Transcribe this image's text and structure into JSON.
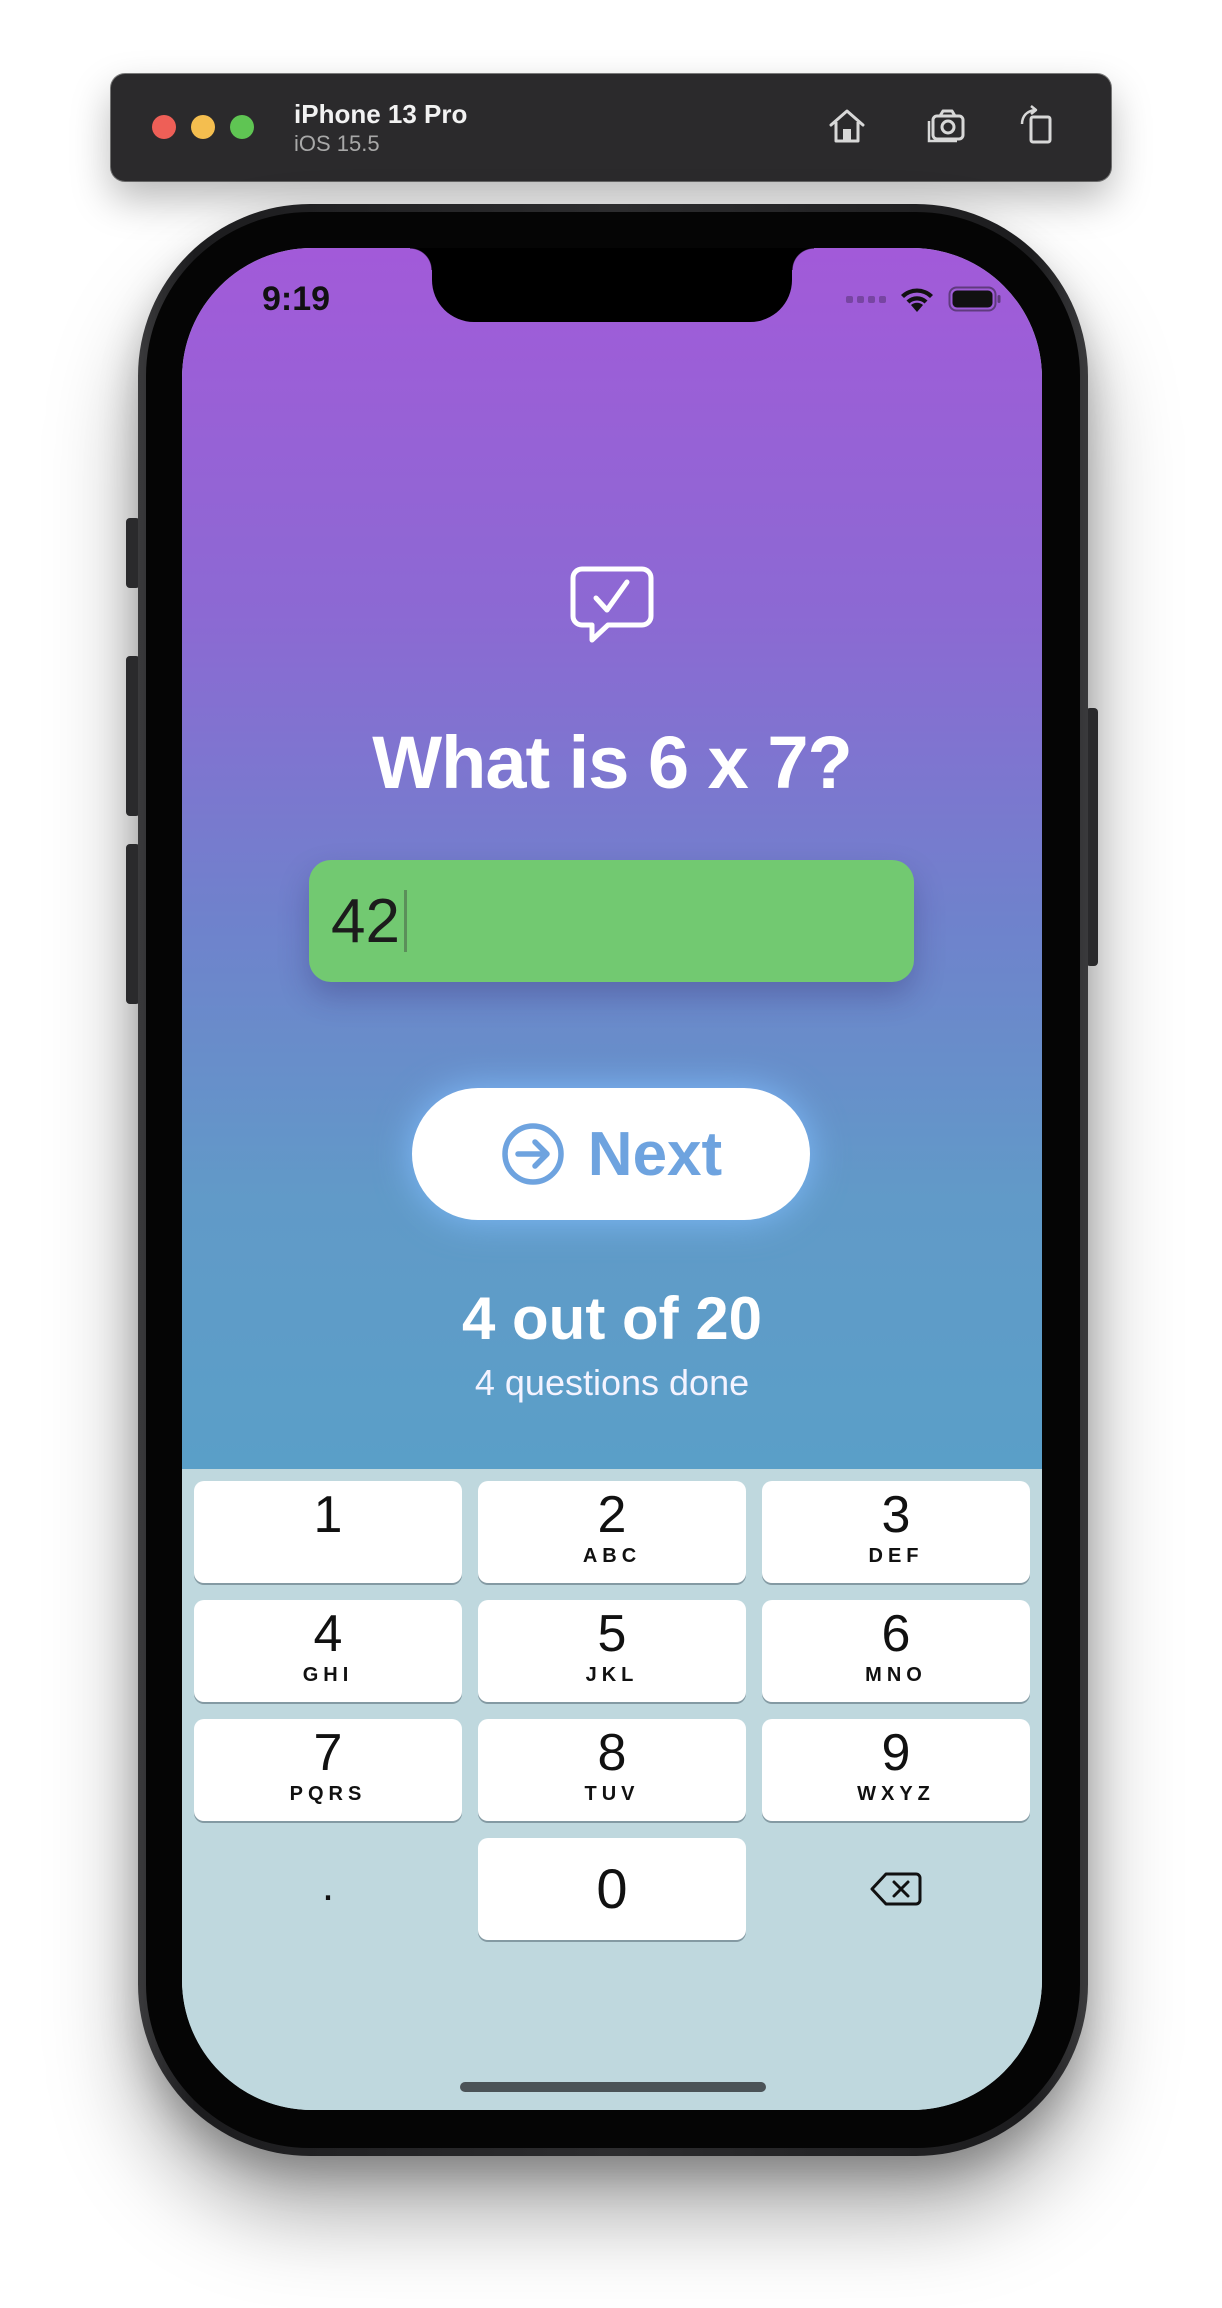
{
  "simulator": {
    "device_name": "iPhone 13 Pro",
    "os_version": "iOS 15.5",
    "buttons": [
      {
        "name": "home-icon"
      },
      {
        "name": "screenshot-icon"
      },
      {
        "name": "rotate-icon"
      }
    ]
  },
  "status_bar": {
    "time": "9:19",
    "icons": [
      "signal-dots-icon",
      "wifi-icon",
      "battery-icon"
    ]
  },
  "app": {
    "header_icon": "chat-checkmark-icon",
    "question": "What is 6 x 7?",
    "answer": {
      "value": "42",
      "state_color": "#72c971"
    },
    "next_button": {
      "icon": "arrow-circle-right-icon",
      "label": "Next",
      "label_color": "#6ea3df"
    },
    "progress": {
      "title": "4 out of 20",
      "subtitle": "4 questions done"
    }
  },
  "keypad": {
    "keys": [
      {
        "digit": "1",
        "letters": ""
      },
      {
        "digit": "2",
        "letters": "ABC"
      },
      {
        "digit": "3",
        "letters": "DEF"
      },
      {
        "digit": "4",
        "letters": "GHI"
      },
      {
        "digit": "5",
        "letters": "JKL"
      },
      {
        "digit": "6",
        "letters": "MNO"
      },
      {
        "digit": "7",
        "letters": "PQRS"
      },
      {
        "digit": "8",
        "letters": "TUV"
      },
      {
        "digit": "9",
        "letters": "WXYZ"
      },
      {
        "digit": "0",
        "letters": ""
      }
    ],
    "decimal_key": ".",
    "delete_icon": "delete-backspace-icon"
  },
  "colors": {
    "gradient_top": "#a25ad9",
    "gradient_bottom": "#5a9fc8",
    "keypad_background": "#bfd8de",
    "answer_correct": "#72c971"
  }
}
